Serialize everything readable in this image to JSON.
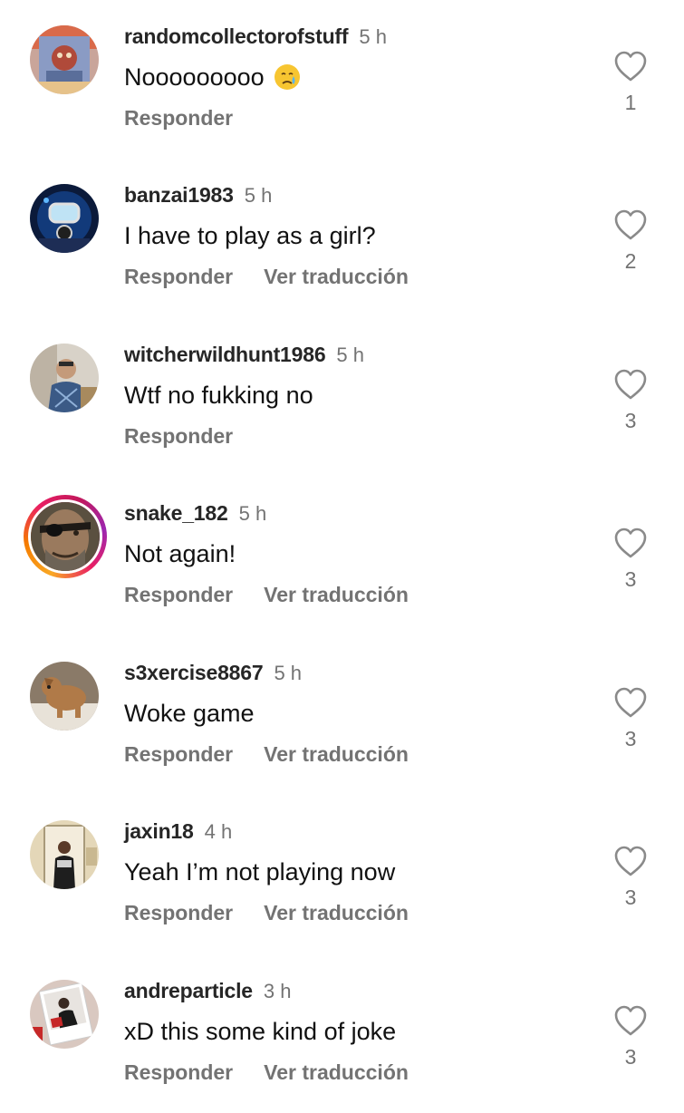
{
  "comments": [
    {
      "username": "randomcollectorofstuff",
      "time": "5 h",
      "text": "Nooooooooo",
      "emoji": "crying-face",
      "reply_label": "Responder",
      "translate_label": "",
      "likes": "1",
      "avatar": "colorful-artwork-avatar"
    },
    {
      "username": "banzai1983",
      "time": "5 h",
      "text": "I have to play as a girl?",
      "reply_label": "Responder",
      "translate_label": "Ver traducción",
      "likes": "2",
      "avatar": "diver-avatar"
    },
    {
      "username": "witcherwildhunt1986",
      "time": "5 h",
      "text": "Wtf no fukking no",
      "reply_label": "Responder",
      "translate_label": "",
      "likes": "3",
      "avatar": "person-photo-avatar"
    },
    {
      "username": "snake_182",
      "time": "5 h",
      "text": "Not again!",
      "reply_label": "Responder",
      "translate_label": "Ver traducción",
      "likes": "3",
      "avatar": "eyepatch-soldier-avatar"
    },
    {
      "username": "s3xercise8867",
      "time": "5 h",
      "text": "Woke game",
      "reply_label": "Responder",
      "translate_label": "Ver traducción",
      "likes": "3",
      "avatar": "dog-avatar"
    },
    {
      "username": "jaxin18",
      "time": "4 h",
      "text": "Yeah I’m not playing now",
      "reply_label": "Responder",
      "translate_label": "Ver traducción",
      "likes": "3",
      "avatar": "doorway-person-avatar"
    },
    {
      "username": "andreparticle",
      "time": "3 h",
      "text": "xD this some kind of joke",
      "reply_label": "Responder",
      "translate_label": "Ver traducción",
      "likes": "3",
      "avatar": "polaroid-avatar"
    }
  ],
  "colors": {
    "secondary_text": "#737373",
    "primary_text": "#111111",
    "story_ring": "#e91e63"
  },
  "icons": {
    "like": "heart-outline-icon"
  }
}
